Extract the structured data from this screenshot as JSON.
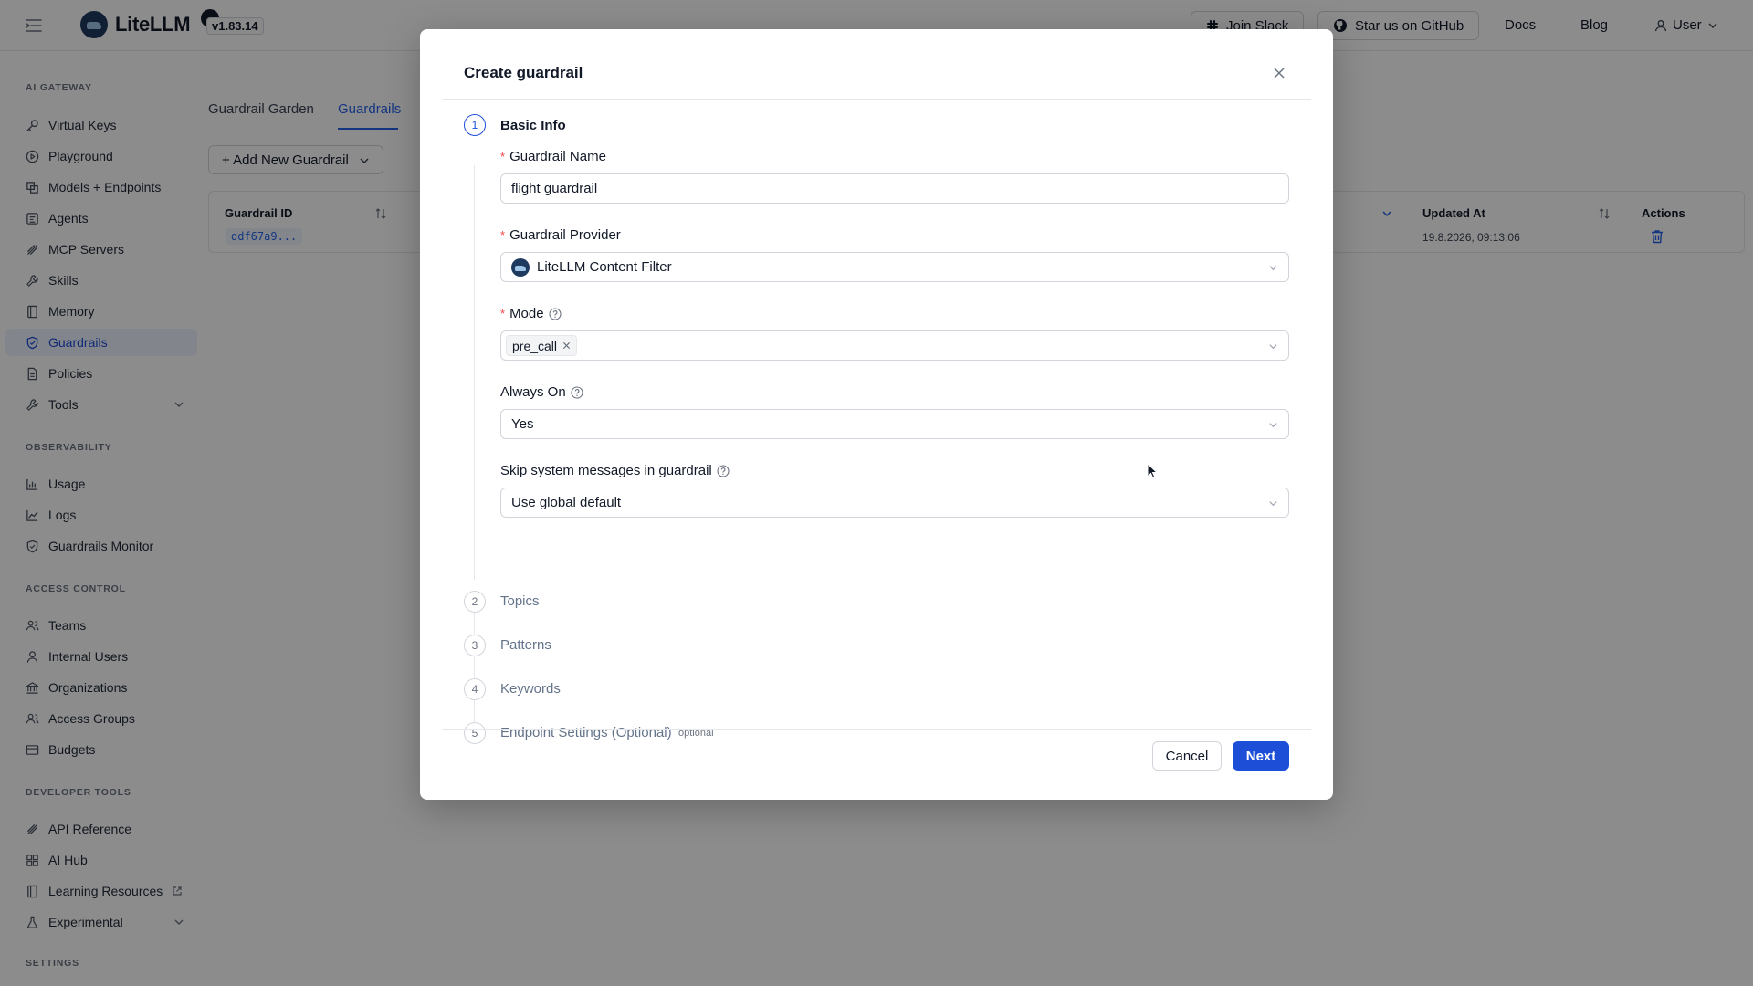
{
  "header": {
    "logo_text": "LiteLLM",
    "version": "v1.83.14",
    "join_slack": "Join Slack",
    "github": "Star us on GitHub",
    "docs": "Docs",
    "blog": "Blog",
    "user": "User"
  },
  "sidebar": {
    "sections": {
      "ai_gateway": "AI GATEWAY",
      "observability": "OBSERVABILITY",
      "access_control": "ACCESS CONTROL",
      "developer_tools": "DEVELOPER TOOLS",
      "settings": "SETTINGS"
    },
    "items": [
      {
        "label": "Virtual Keys",
        "icon": "key-icon"
      },
      {
        "label": "Playground",
        "icon": "play-icon"
      },
      {
        "label": "Models + Endpoints",
        "icon": "cube-icon"
      },
      {
        "label": "Agents",
        "icon": "robot-icon"
      },
      {
        "label": "MCP Servers",
        "icon": "server-icon"
      },
      {
        "label": "Skills",
        "icon": "wrench-icon"
      },
      {
        "label": "Memory",
        "icon": "book-icon"
      },
      {
        "label": "Guardrails",
        "icon": "shield-icon"
      },
      {
        "label": "Policies",
        "icon": "document-icon"
      },
      {
        "label": "Tools",
        "icon": "tool-icon"
      },
      {
        "label": "Usage",
        "icon": "bar-chart-icon"
      },
      {
        "label": "Logs",
        "icon": "line-chart-icon"
      },
      {
        "label": "Guardrails Monitor",
        "icon": "shield-check-icon"
      },
      {
        "label": "Teams",
        "icon": "team-icon"
      },
      {
        "label": "Internal Users",
        "icon": "user-icon"
      },
      {
        "label": "Organizations",
        "icon": "bank-icon"
      },
      {
        "label": "Access Groups",
        "icon": "group-icon"
      },
      {
        "label": "Budgets",
        "icon": "wallet-icon"
      },
      {
        "label": "API Reference",
        "icon": "api-icon"
      },
      {
        "label": "AI Hub",
        "icon": "grid-icon"
      },
      {
        "label": "Learning Resources",
        "icon": "book-icon"
      },
      {
        "label": "Experimental",
        "icon": "flask-icon"
      }
    ],
    "active": "Guardrails"
  },
  "main": {
    "tabs": [
      "Guardrail Garden",
      "Guardrails"
    ],
    "active_tab": "Guardrails",
    "add_button": "+ Add New Guardrail",
    "table": {
      "headers": [
        "Guardrail ID",
        "Updated At",
        "Actions"
      ],
      "rows": [
        {
          "id": "ddf67a9...",
          "updated_at": "19.8.2026, 09:13:06"
        }
      ]
    }
  },
  "modal": {
    "title": "Create guardrail",
    "steps": [
      {
        "num": "1",
        "label": "Basic Info"
      },
      {
        "num": "2",
        "label": "Topics"
      },
      {
        "num": "3",
        "label": "Patterns"
      },
      {
        "num": "4",
        "label": "Keywords"
      },
      {
        "num": "5",
        "label": "Endpoint Settings (Optional)",
        "tag": "optional"
      }
    ],
    "fields": {
      "name_label": "Guardrail Name",
      "name_value": "flight guardrail",
      "provider_label": "Guardrail Provider",
      "provider_value": "LiteLLM Content Filter",
      "mode_label": "Mode",
      "mode_tag": "pre_call",
      "always_on_label": "Always On",
      "always_on_value": "Yes",
      "skip_label": "Skip system messages in guardrail",
      "skip_value": "Use global default"
    },
    "cancel": "Cancel",
    "next": "Next"
  },
  "colors": {
    "accent": "#1d4ed8",
    "link": "#2563eb",
    "required": "#ef4444",
    "overlay": "rgba(0,0,0,0.45)"
  }
}
